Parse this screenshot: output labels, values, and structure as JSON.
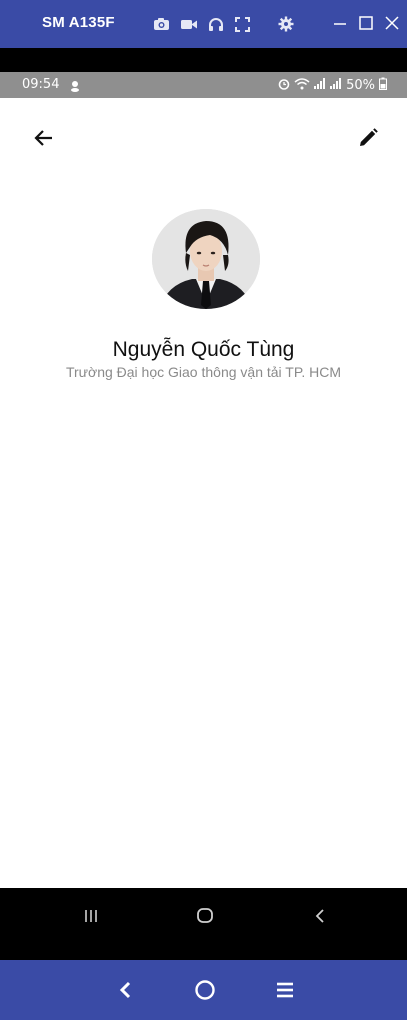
{
  "window": {
    "title": "SM A135F",
    "tools": [
      "camera-icon",
      "video-icon",
      "headphones-icon",
      "fullscreen-icon",
      "gear-icon"
    ],
    "controls": [
      "minimize-icon",
      "maximize-icon",
      "close-icon"
    ]
  },
  "status_bar": {
    "time": "09:54",
    "battery": "50%"
  },
  "profile": {
    "name": "Nguyễn Quốc Tùng",
    "school": "Trường Đại học Giao thông vận tải TP. HCM"
  },
  "colors": {
    "window_bar": "#3a4ba6",
    "status_bar": "#8f8f8f",
    "subtitle": "#8a8a8a"
  }
}
